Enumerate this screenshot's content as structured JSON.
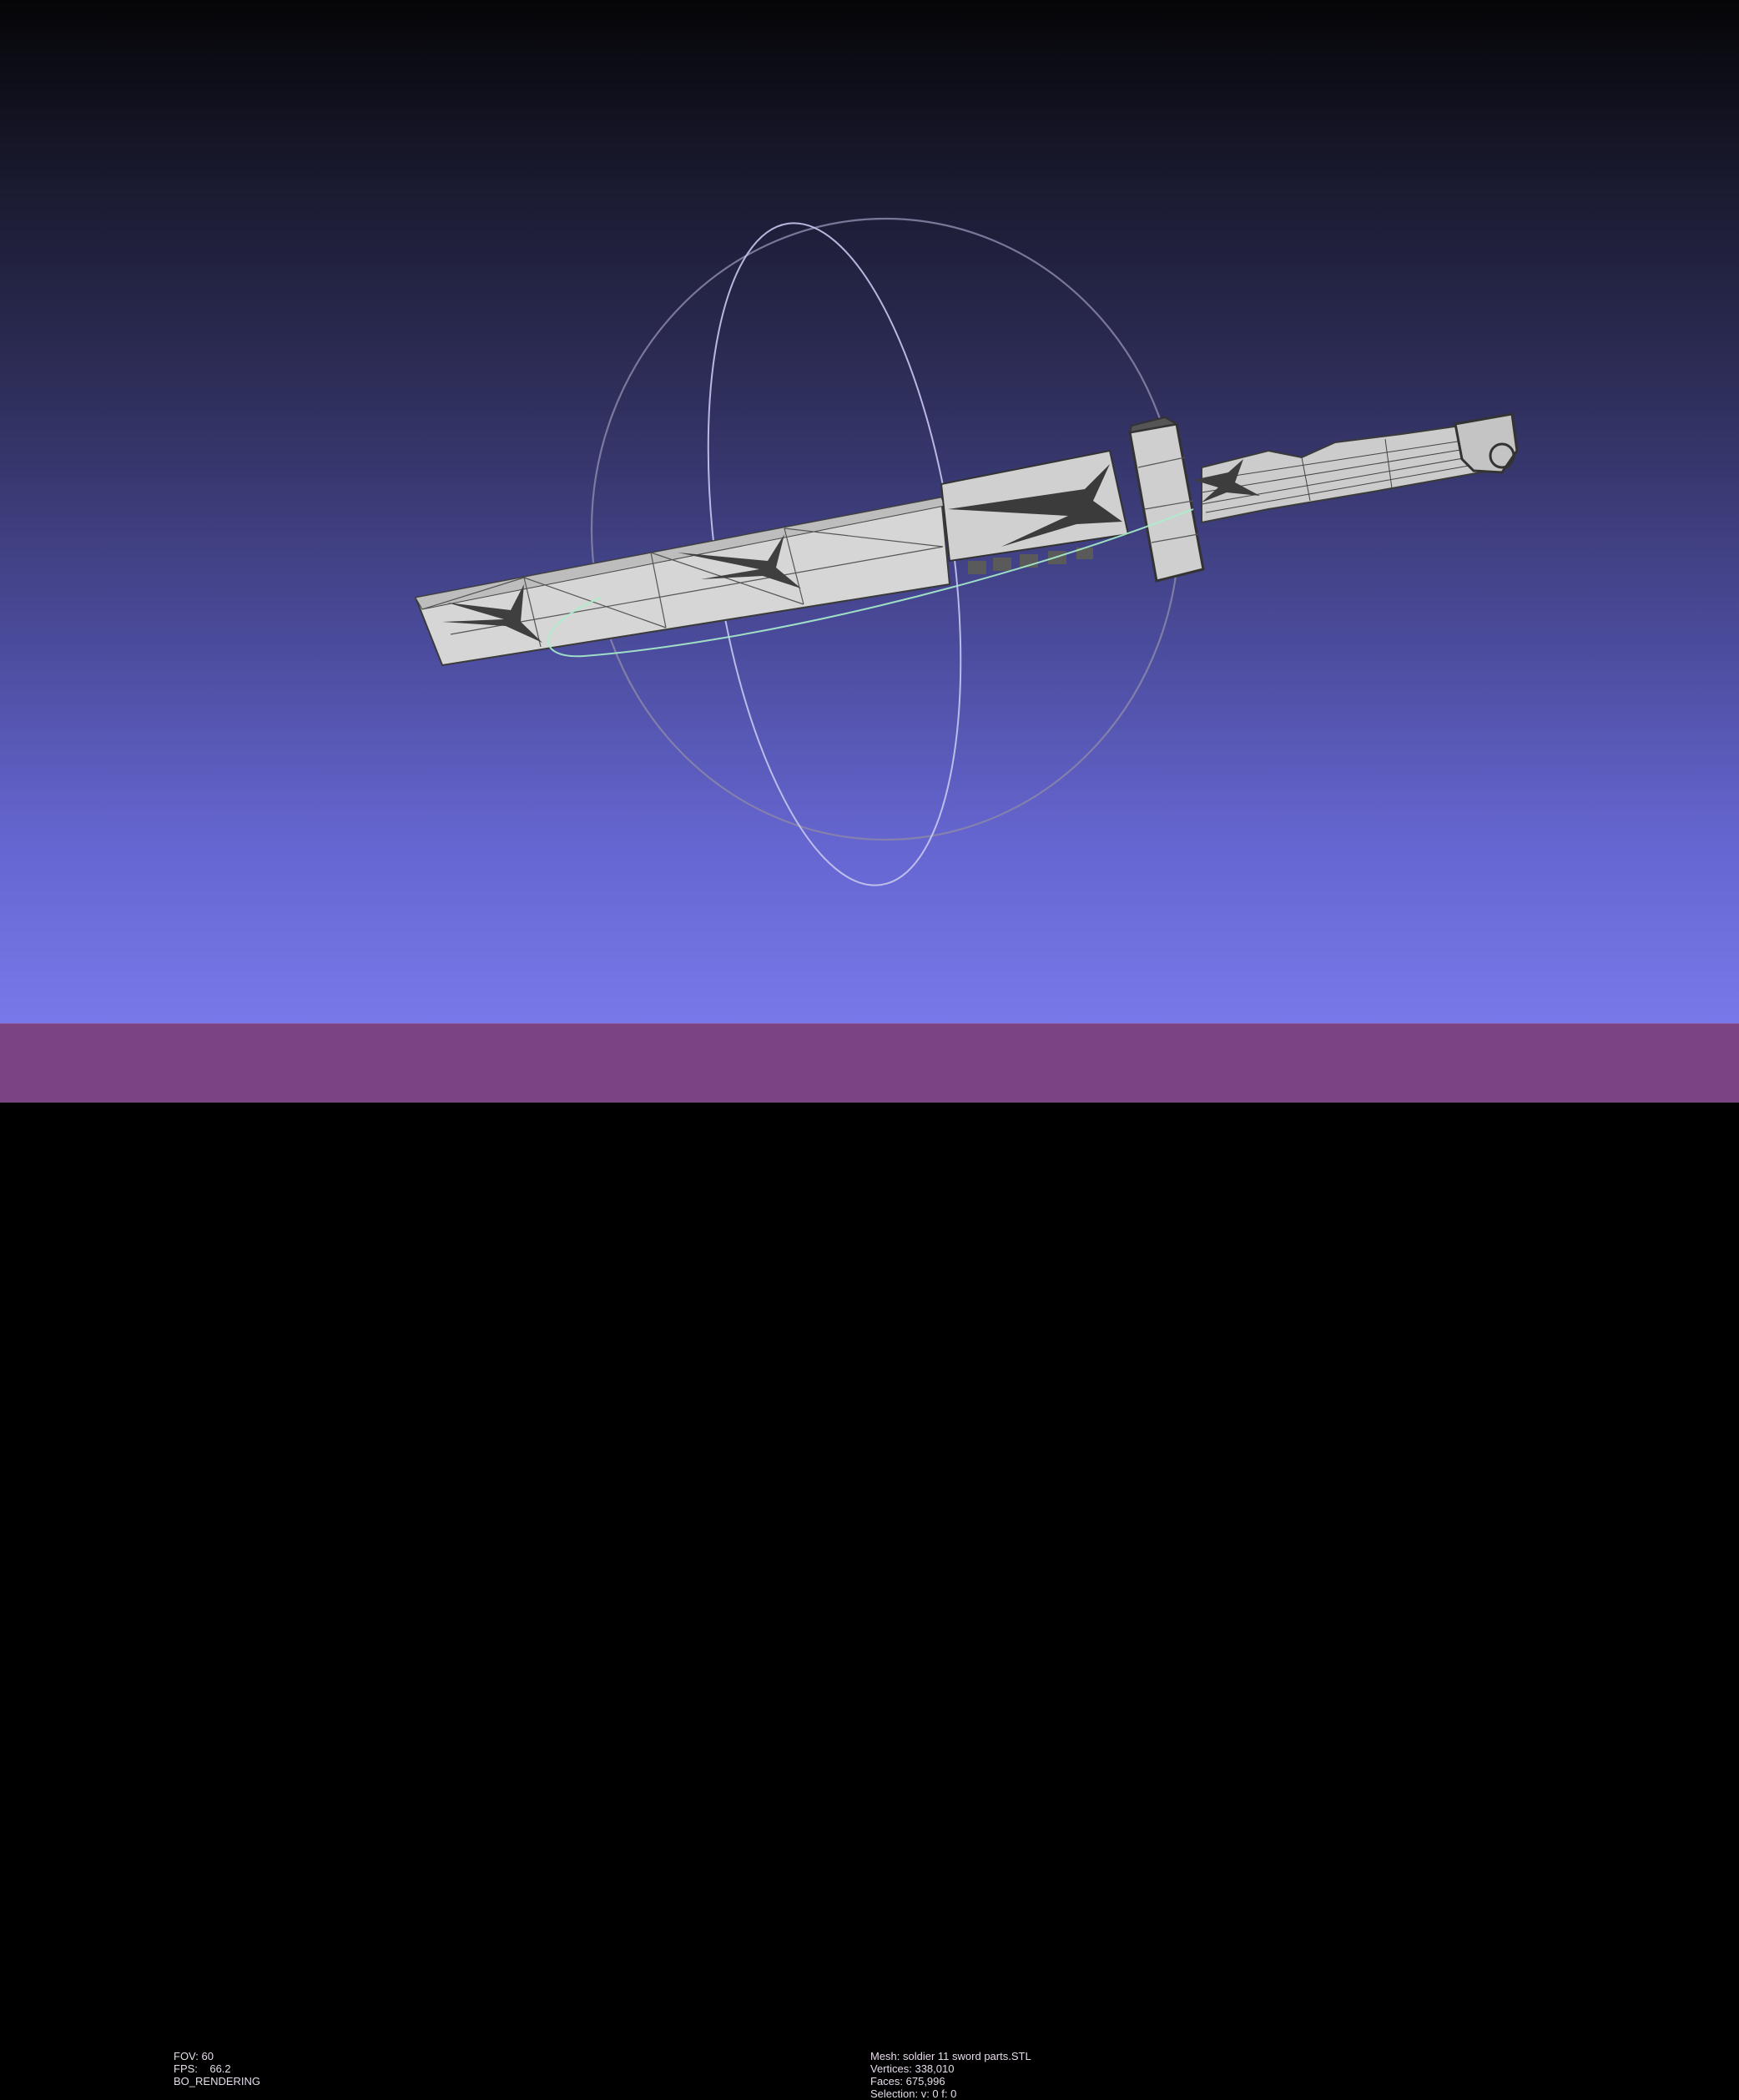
{
  "viewer": {
    "background_top": "#050507",
    "background_bottom": "#7878ea",
    "status_bar_color": "#7a4482",
    "trackball": {
      "equator_color": "#7f7fa8",
      "vertical_ring_color": "#c8c8f0",
      "horizontal_ring_color": "#a0f0c8"
    },
    "mesh_color": "#d4d4d4"
  },
  "left_info": {
    "fov": "FOV: 60",
    "fps": "FPS:    66.2",
    "mode": "BO_RENDERING"
  },
  "right_info": {
    "mesh": "Mesh: soldier 11 sword parts.STL",
    "vertices": "Vertices: 338,010",
    "faces": "Faces: 675,996",
    "selection": "Selection: v: 0 f: 0"
  }
}
